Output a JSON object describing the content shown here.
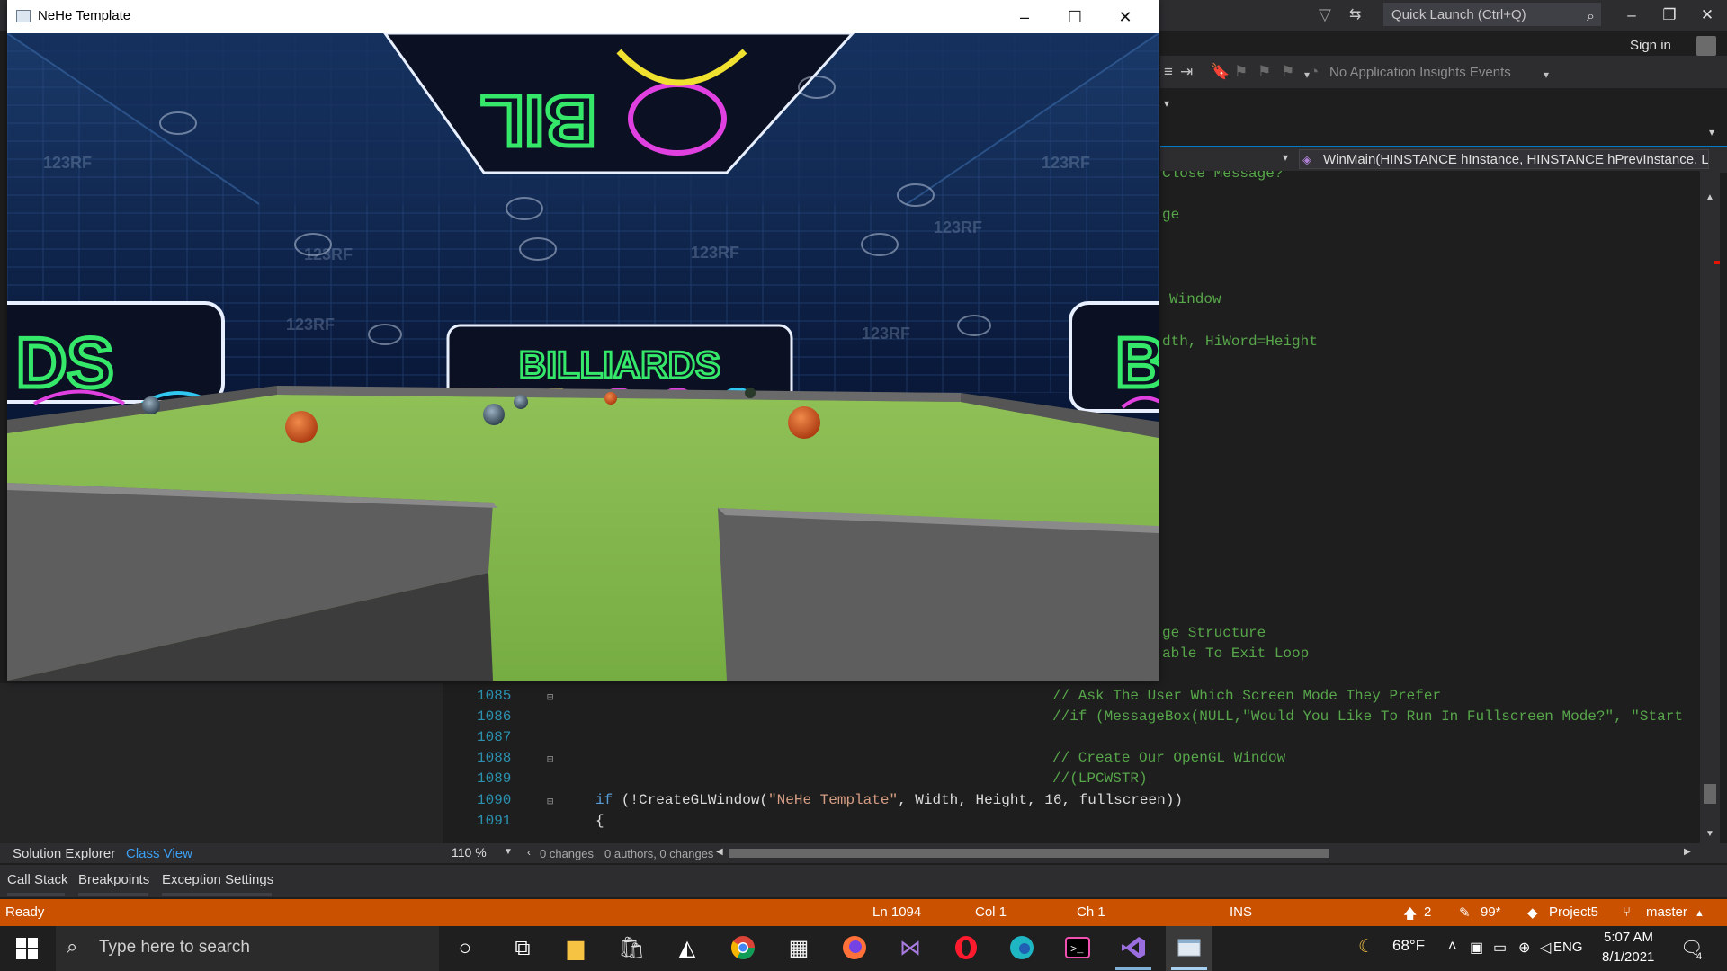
{
  "vs": {
    "quick_launch_placeholder": "Quick Launch (Ctrl+Q)",
    "sign_in": "Sign in",
    "insights": "No Application Insights Events",
    "function_dropdown": "WinMain(HINSTANCE hInstance, HINSTANCE hPrevInstance, LPSTR",
    "zoom": "110 %",
    "changes": "0 changes",
    "authors": "0 authors, 0 changes",
    "panel_tabs": [
      "Solution Explorer",
      "Class View"
    ],
    "bottom_tabs": [
      "Call Stack",
      "Breakpoints",
      "Exception Settings"
    ],
    "status": {
      "ready": "Ready",
      "line": "Ln 1094",
      "col": "Col 1",
      "ch": "Ch 1",
      "ins": "INS",
      "up_count": "2",
      "pencil_count": "99*",
      "project": "Project5",
      "branch": "master"
    },
    "code_partial": [
      "Close Message?",
      "ge",
      "Window",
      "dth, HiWord=Height",
      "ge Structure",
      "able To Exit Loop"
    ],
    "code_lines": [
      {
        "num": "1085",
        "text": "// Ask The User Which Screen Mode They Prefer"
      },
      {
        "num": "1086",
        "text": "//if (MessageBox(NULL,\"Would You Like To Run In Fullscreen Mode?\", \"Start"
      },
      {
        "num": "1087",
        "text": ""
      },
      {
        "num": "1088",
        "text": "// Create Our OpenGL Window"
      },
      {
        "num": "1089",
        "text": "//(LPCWSTR)"
      },
      {
        "num": "1090",
        "kw": "if",
        "pre": " (!CreateGLWindow(",
        "str": "\"NeHe Template\"",
        "post": ", Width, Height, 16, fullscreen))"
      },
      {
        "num": "1091",
        "text": "{"
      }
    ]
  },
  "nehe": {
    "title": "NeHe Template",
    "scene": {
      "sign_center": "BILLIARDS",
      "sign_left": "DS",
      "sign_right": "B",
      "sign_top": "BIL",
      "watermark": "123RF"
    }
  },
  "taskbar": {
    "search_placeholder": "Type here to search",
    "weather": "68°F",
    "lang": "ENG",
    "time": "5:07 AM",
    "date": "8/1/2021",
    "notifications": "4"
  },
  "colors": {
    "vs_accent": "#007acc",
    "status_bar": "#ca5100",
    "felt": "#7fb24a"
  }
}
